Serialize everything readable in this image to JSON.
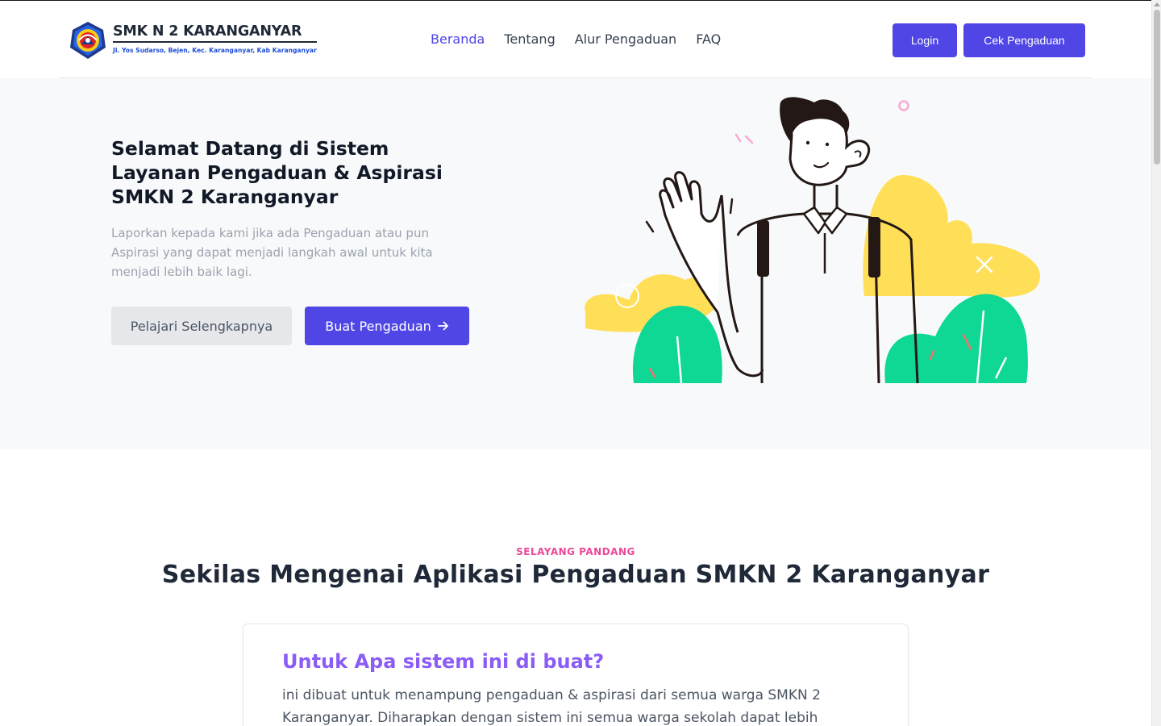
{
  "brand": {
    "name": "SMK N 2 KARANGANYAR",
    "address": "Jl. Yos Sudarso, Bejen, Kec. Karanganyar, Kab Karanganyar"
  },
  "nav": {
    "items": [
      {
        "label": "Beranda",
        "active": true
      },
      {
        "label": "Tentang",
        "active": false
      },
      {
        "label": "Alur Pengaduan",
        "active": false
      },
      {
        "label": "FAQ",
        "active": false
      }
    ]
  },
  "header_buttons": {
    "login": "Login",
    "check": "Cek Pengaduan"
  },
  "hero": {
    "title": "Selamat Datang di Sistem Layanan Pengaduan & Aspirasi SMKN 2 Karanganyar",
    "description": "Laporkan kepada kami jika ada Pengaduan atau pun Aspirasi yang dapat menjadi langkah awal untuk kita menjadi lebih baik lagi.",
    "secondary_button": "Pelajari Selengkapnya",
    "primary_button": "Buat Pengaduan"
  },
  "about": {
    "eyebrow": "SELAYANG PANDANG",
    "title": "Sekilas Mengenai Aplikasi Pengaduan SMKN 2 Karanganyar",
    "card_title": "Untuk Apa sistem ini di buat?",
    "card_text": "ini dibuat untuk menampung pengaduan & aspirasi dari semua warga SMKN 2 Karanganyar. Diharapkan dengan sistem ini semua warga sekolah dapat lebih"
  },
  "colors": {
    "primary": "#4f46e5",
    "accent_pink": "#ec4899",
    "accent_purple": "#8b5cf6",
    "illustration_yellow": "#ffdf57",
    "illustration_green": "#0fd794"
  },
  "icons": {
    "button_arrow": "arrow-right-icon",
    "logo": "school-emblem-icon"
  }
}
